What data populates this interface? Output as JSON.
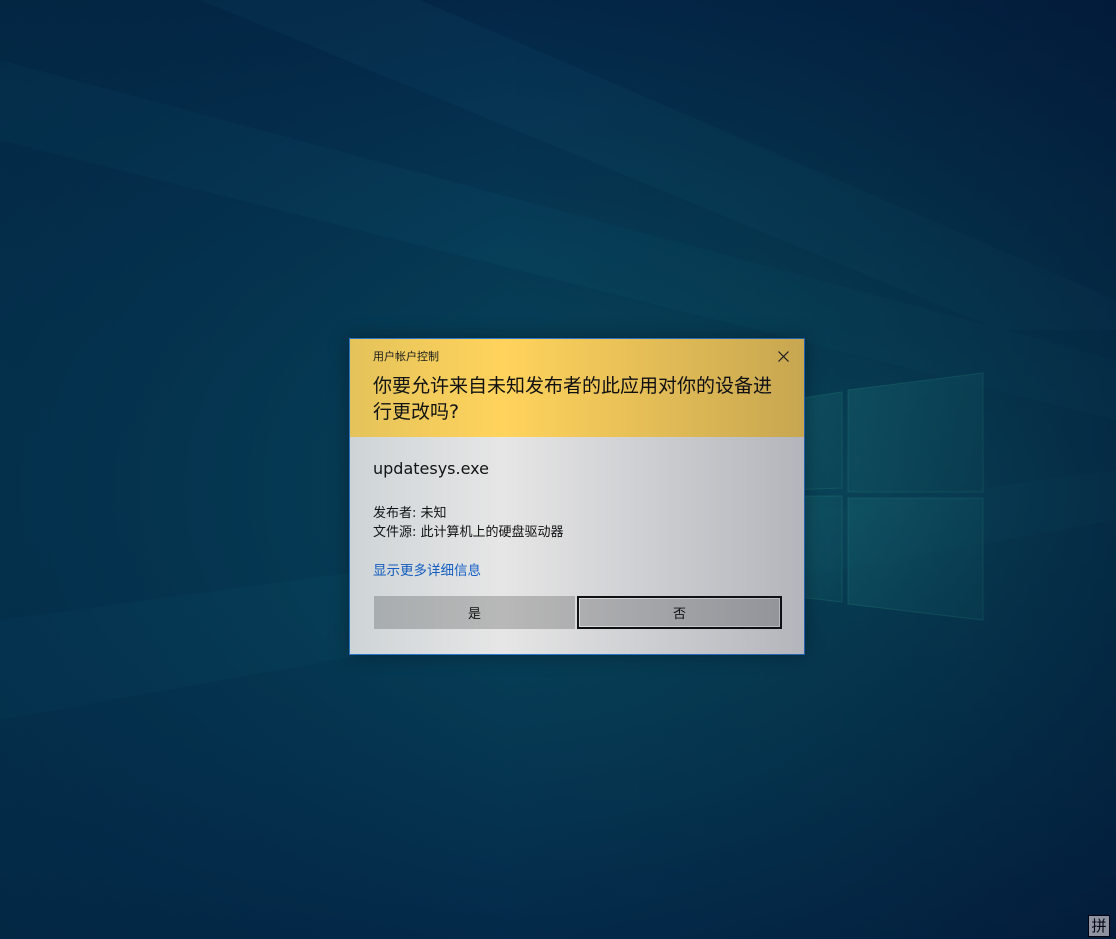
{
  "dialog": {
    "caption": "用户帐户控制",
    "question": "你要允许来自未知发布者的此应用对你的设备进行更改吗?",
    "app_name": "updatesys.exe",
    "publisher": "发布者: 未知",
    "file_source": "文件源: 此计算机上的硬盘驱动器",
    "more_details_link": "显示更多详细信息",
    "yes_button": "是",
    "no_button": "否",
    "close_icon": "close-icon",
    "colors": {
      "header": "#ffd35c",
      "body": "#e6e6e6",
      "border": "#2b79d0",
      "link": "#1560c8",
      "button": "#b8b8b8"
    }
  },
  "taskbar": {
    "ime_indicator": "拼"
  },
  "desktop": {
    "wallpaper": "windows-10-hero-dark-blue",
    "logo_icon": "windows-logo-icon"
  }
}
